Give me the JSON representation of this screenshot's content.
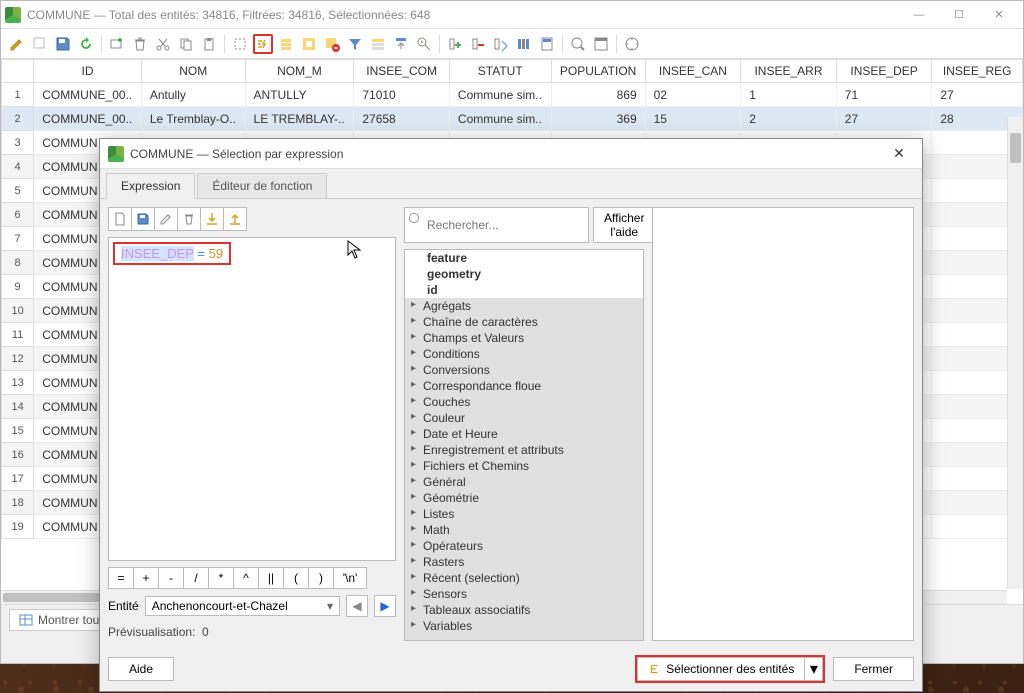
{
  "window": {
    "title": "COMMUNE — Total des entités: 34816, Filtrées: 34816, Sélectionnées: 648"
  },
  "columns": [
    "ID",
    "NOM",
    "NOM_M",
    "INSEE_COM",
    "STATUT",
    "POPULATION",
    "INSEE_CAN",
    "INSEE_ARR",
    "INSEE_DEP",
    "INSEE_REG"
  ],
  "rows": [
    {
      "n": "1",
      "cells": [
        "COMMUNE_00..",
        "Antully",
        "ANTULLY",
        "71010",
        "Commune sim..",
        "869",
        "02",
        "1",
        "71",
        "27"
      ]
    },
    {
      "n": "2",
      "cells": [
        "COMMUNE_00..",
        "Le Tremblay-O..",
        "LE TREMBLAY-..",
        "27658",
        "Commune sim..",
        "369",
        "15",
        "2",
        "27",
        "28"
      ],
      "sel": true
    },
    {
      "n": "3",
      "cells": [
        "COMMUN",
        "",
        "",
        "",
        "",
        "",
        "",
        "",
        "",
        ""
      ]
    },
    {
      "n": "4",
      "cells": [
        "COMMUN",
        "",
        "",
        "",
        "",
        "",
        "",
        "",
        "",
        ""
      ],
      "alt": true
    },
    {
      "n": "5",
      "cells": [
        "COMMUN",
        "",
        "",
        "",
        "",
        "",
        "",
        "",
        "",
        ""
      ]
    },
    {
      "n": "6",
      "cells": [
        "COMMUN",
        "",
        "",
        "",
        "",
        "",
        "",
        "",
        "",
        ""
      ],
      "alt": true
    },
    {
      "n": "7",
      "cells": [
        "COMMUN",
        "",
        "",
        "",
        "",
        "",
        "",
        "",
        "",
        ""
      ]
    },
    {
      "n": "8",
      "cells": [
        "COMMUN",
        "",
        "",
        "",
        "",
        "",
        "",
        "",
        "",
        ""
      ],
      "alt": true
    },
    {
      "n": "9",
      "cells": [
        "COMMUN",
        "",
        "",
        "",
        "",
        "",
        "",
        "",
        "",
        ""
      ]
    },
    {
      "n": "10",
      "cells": [
        "COMMUN",
        "",
        "",
        "",
        "",
        "",
        "",
        "",
        "",
        ""
      ],
      "alt": true
    },
    {
      "n": "11",
      "cells": [
        "COMMUN",
        "",
        "",
        "",
        "",
        "",
        "",
        "",
        "",
        ""
      ]
    },
    {
      "n": "12",
      "cells": [
        "COMMUN",
        "",
        "",
        "",
        "",
        "",
        "",
        "",
        "",
        ""
      ],
      "alt": true
    },
    {
      "n": "13",
      "cells": [
        "COMMUN",
        "",
        "",
        "",
        "",
        "",
        "",
        "",
        "",
        ""
      ]
    },
    {
      "n": "14",
      "cells": [
        "COMMUN",
        "",
        "",
        "",
        "",
        "",
        "",
        "",
        "",
        ""
      ],
      "alt": true
    },
    {
      "n": "15",
      "cells": [
        "COMMUN",
        "",
        "",
        "",
        "",
        "",
        "",
        "",
        "",
        ""
      ]
    },
    {
      "n": "16",
      "cells": [
        "COMMUN",
        "",
        "",
        "",
        "",
        "",
        "",
        "",
        "",
        ""
      ],
      "alt": true
    },
    {
      "n": "17",
      "cells": [
        "COMMUN",
        "",
        "",
        "",
        "",
        "",
        "",
        "",
        "",
        ""
      ]
    },
    {
      "n": "18",
      "cells": [
        "COMMUN",
        "",
        "",
        "",
        "",
        "",
        "",
        "",
        "",
        ""
      ],
      "alt": true
    },
    {
      "n": "19",
      "cells": [
        "COMMUN",
        "",
        "",
        "",
        "",
        "",
        "",
        "",
        "",
        ""
      ]
    }
  ],
  "status": {
    "showAll": "Montrer toutes"
  },
  "dialog": {
    "title": "COMMUNE — Sélection par expression",
    "tabs": {
      "expr": "Expression",
      "func": "Éditeur de fonction"
    },
    "expression": {
      "field": "INSEE_DEP",
      "op": "=",
      "val": "59"
    },
    "ops": [
      "=",
      "+",
      "-",
      "/",
      "*",
      "^",
      "||",
      "(",
      ")",
      "'\\n'"
    ],
    "entity": {
      "label": "Entité",
      "value": "Anchenoncourt-et-Chazel"
    },
    "preview": {
      "label": "Prévisualisation:",
      "value": "0"
    },
    "search": {
      "placeholder": "Rechercher...",
      "help": "Afficher l'aide"
    },
    "tree": {
      "bold": [
        "feature",
        "geometry",
        "id"
      ],
      "cats": [
        "Agrégats",
        "Chaîne de caractères",
        "Champs et Valeurs",
        "Conditions",
        "Conversions",
        "Correspondance floue",
        "Couches",
        "Couleur",
        "Date et Heure",
        "Enregistrement et attributs",
        "Fichiers et Chemins",
        "Général",
        "Géométrie",
        "Listes",
        "Math",
        "Opérateurs",
        "Rasters",
        "Récent (selection)",
        "Sensors",
        "Tableaux associatifs",
        "Variables"
      ]
    },
    "footer": {
      "help": "Aide",
      "select": "Sélectionner des entités",
      "close": "Fermer"
    }
  }
}
